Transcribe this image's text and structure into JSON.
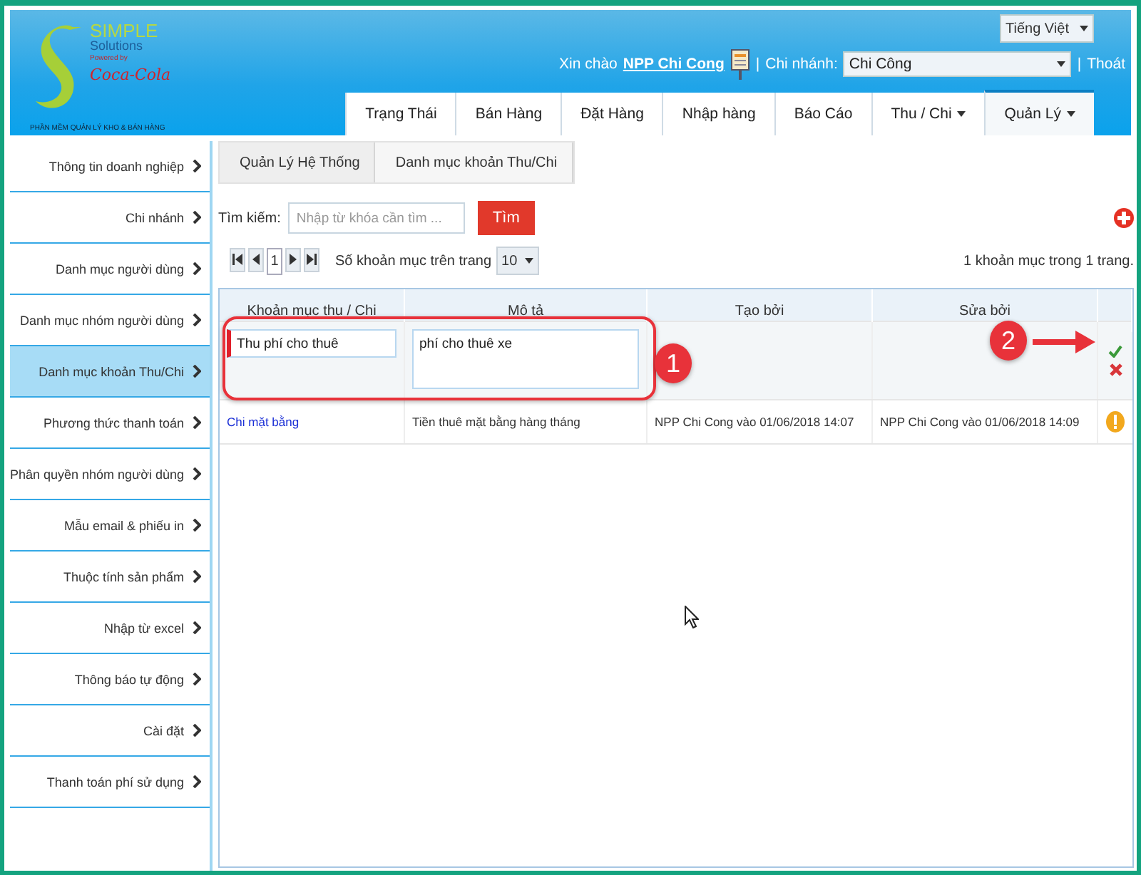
{
  "logo": {
    "brand": "SIMPLE",
    "sub": "Solutions",
    "powered": "Powered by",
    "partner": "Coca-Cola",
    "tagline": "PHẦN MỀM QUẢN LÝ KHO & BÁN HÀNG"
  },
  "language": {
    "value": "Tiếng Việt"
  },
  "user_bar": {
    "greeting": "Xin chào",
    "user": "NPP Chi Cong",
    "separator_1": "|",
    "branch_label": "Chi nhánh:",
    "branch": "Chi Công",
    "separator_2": "|",
    "logout": "Thoát"
  },
  "tabs": [
    {
      "label": "Trạng Thái",
      "dropdown": false,
      "selected": false
    },
    {
      "label": "Bán Hàng",
      "dropdown": false,
      "selected": false
    },
    {
      "label": "Đặt Hàng",
      "dropdown": false,
      "selected": false
    },
    {
      "label": "Nhập hàng",
      "dropdown": false,
      "selected": false
    },
    {
      "label": "Báo Cáo",
      "dropdown": false,
      "selected": false
    },
    {
      "label": "Thu / Chi",
      "dropdown": true,
      "selected": false
    },
    {
      "label": "Quản Lý",
      "dropdown": true,
      "selected": true
    }
  ],
  "sidebar": {
    "items": [
      {
        "label": "Thông tin doanh nghiệp",
        "selected": false
      },
      {
        "label": "Chi nhánh",
        "selected": false
      },
      {
        "label": "Danh mục người dùng",
        "selected": false
      },
      {
        "label": "Danh mục nhóm người dùng",
        "selected": false
      },
      {
        "label": "Danh mục khoản Thu/Chi",
        "selected": true
      },
      {
        "label": "Phương thức thanh toán",
        "selected": false
      },
      {
        "label": "Phân quyền nhóm người dùng",
        "selected": false
      },
      {
        "label": "Mẫu email & phiếu in",
        "selected": false
      },
      {
        "label": "Thuộc tính sản phẩm",
        "selected": false
      },
      {
        "label": "Nhập từ excel",
        "selected": false
      },
      {
        "label": "Thông báo tự động",
        "selected": false
      },
      {
        "label": "Cài đặt",
        "selected": false
      },
      {
        "label": "Thanh toán phí sử dụng",
        "selected": false
      }
    ]
  },
  "breadcrumb": [
    "Quản Lý Hệ Thống",
    "Danh mục khoản Thu/Chi"
  ],
  "search": {
    "label": "Tìm kiếm:",
    "placeholder": "Nhập từ khóa cần tìm ...",
    "button": "Tìm"
  },
  "pager": {
    "page": "1",
    "per_page_label": "Số khoản mục trên trang",
    "per_page": "10",
    "summary": "1 khoản mục trong 1 trang."
  },
  "table": {
    "columns": [
      "Khoản mục thu / Chi",
      "Mô tả",
      "Tạo bởi",
      "Sửa bởi"
    ],
    "edit_row": {
      "name": "Thu phí cho thuê",
      "description": "phí cho thuê xe"
    },
    "rows": [
      {
        "name": "Chi mặt bằng",
        "description": "Tiền thuê mặt bằng hàng tháng",
        "created": "NPP Chi Cong vào 01/06/2018 14:07",
        "modified": "NPP Chi Cong vào 01/06/2018 14:09"
      }
    ]
  },
  "annotations": [
    {
      "label": "1"
    },
    {
      "label": "2"
    }
  ]
}
